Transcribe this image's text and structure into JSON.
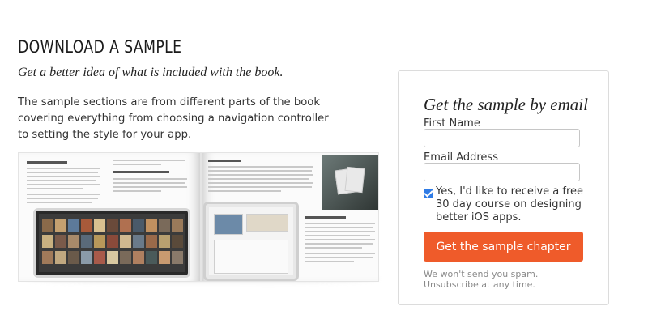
{
  "section": {
    "heading": "DOWNLOAD A SAMPLE",
    "subtitle": "Get a better idea of what is included with the book.",
    "description": "The sample sections are from different parts of the book covering everything from choosing a navigation controller to setting the style for your app."
  },
  "signup": {
    "title": "Get the sample by email",
    "first_name_label": "First Name",
    "first_name_value": "",
    "email_label": "Email Address",
    "email_value": "",
    "consent_checked": true,
    "consent_text": "Yes, I'd like to receive a free 30 day course on designing better iOS apps.",
    "button_label": "Get the sample chapter",
    "disclaimer": "We won't send you spam. Unsubscribe at any time."
  },
  "colors": {
    "button": "#ef5b2a",
    "checkbox": "#2f7be5"
  }
}
